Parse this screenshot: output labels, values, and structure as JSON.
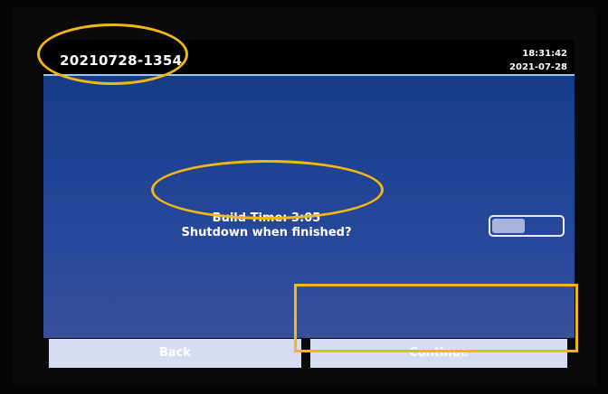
{
  "header": {
    "build_id": "20210728-1354",
    "time": "18:31:42",
    "date": "2021-07-28"
  },
  "message": {
    "line1": "Build Time: 3:05",
    "line2": "Shutdown when finished?"
  },
  "toggle": {
    "state": "off"
  },
  "buttons": {
    "back": "Back",
    "continue": "Continue"
  },
  "colors": {
    "background_top": "#173c86",
    "background_bottom": "#3a4f9a",
    "header_rule": "#9fc6e8",
    "button_fill": "#d6dcf2",
    "annotation": "#f2b711"
  }
}
